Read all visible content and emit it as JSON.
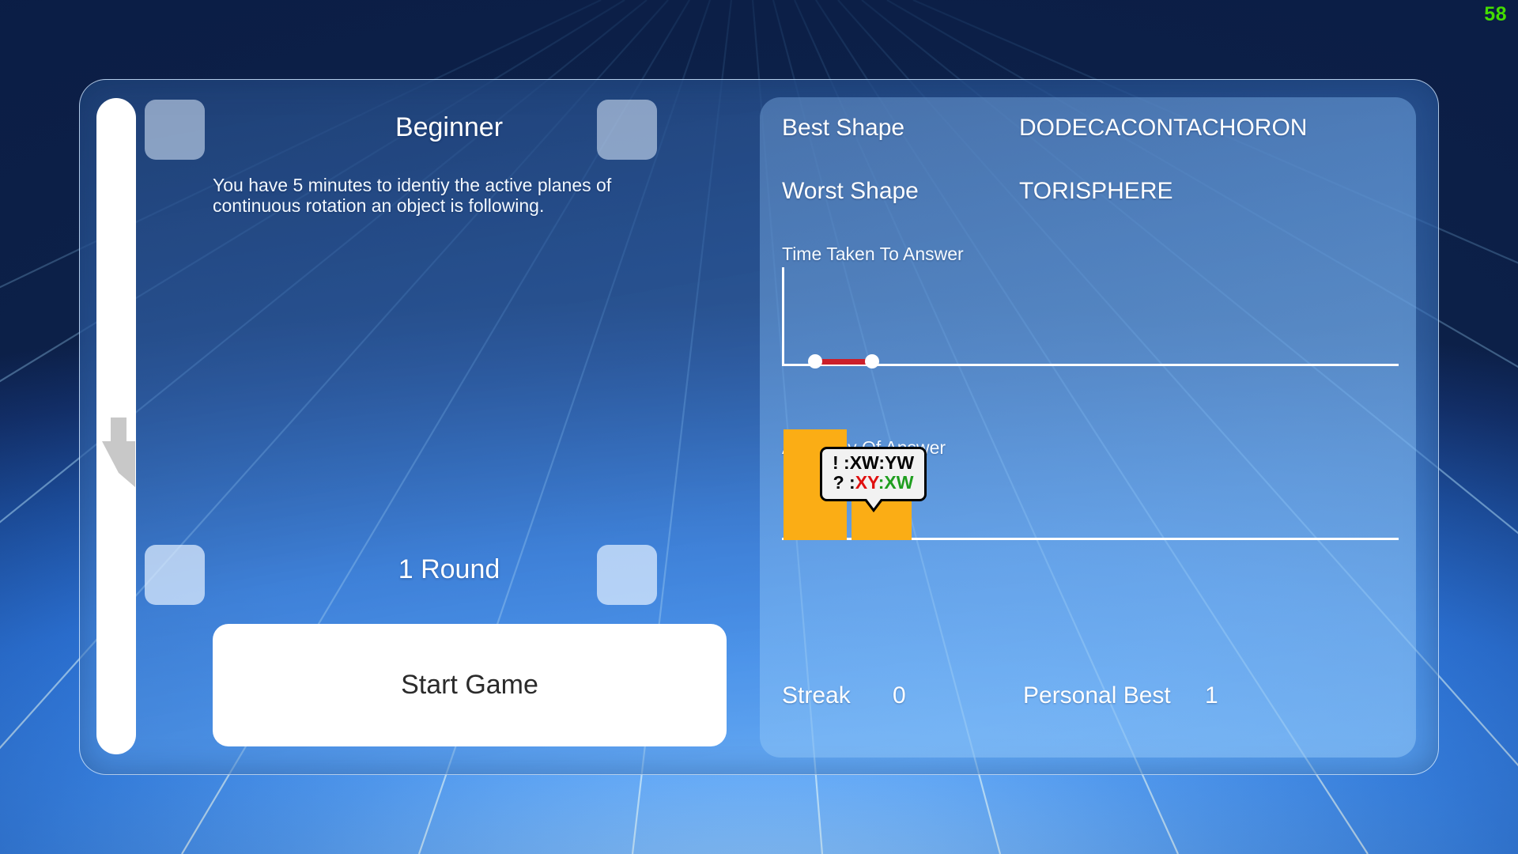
{
  "hud": {
    "fps": "58"
  },
  "difficulty": {
    "label": "Beginner",
    "prev_icon": "chevron-left-icon",
    "next_icon": "chevron-right-icon",
    "description": "You have 5 minutes to identiy the active planes of continuous rotation an object is following."
  },
  "rounds": {
    "label": "1 Round",
    "prev_icon": "chevron-left-icon",
    "next_icon": "chevron-right-icon"
  },
  "start": {
    "label": "Start Game"
  },
  "scrollbar": {
    "handle_icon": "cursor-arrow-icon"
  },
  "stats": {
    "best_shape": {
      "key": "Best Shape",
      "value": "DODECACONTACHORON"
    },
    "worst_shape": {
      "key": "Worst Shape",
      "value": "TORISPHERE"
    },
    "streak": {
      "key": "Streak",
      "value": "0"
    },
    "personal_best": {
      "key": "Personal Best",
      "value": "1"
    }
  },
  "tooltip": {
    "line1_prefix": "! :",
    "line1_value": "XW:YW",
    "line2_prefix": "? :",
    "line2_wrong": "XY",
    "line2_sep": ":",
    "line2_right": "XW"
  },
  "colors": {
    "accent_orange": "#fbad15",
    "line_red": "#cc1f2a",
    "fps_green": "#44dd00",
    "wrong_red": "#e01010",
    "correct_green": "#1f9e1f"
  },
  "chart_data": [
    {
      "type": "line",
      "title": "Time Taken To Answer",
      "xlabel": "",
      "ylabel": "",
      "grid": false,
      "legend": "none",
      "x": [
        1,
        2
      ],
      "series": [
        {
          "name": "Time Taken To Answer",
          "values": [
            0,
            0
          ],
          "color": "#cc1f2a"
        }
      ],
      "ylim": [
        0,
        10
      ],
      "markers": true,
      "marker_color": "#ffffff"
    },
    {
      "type": "bar",
      "title": "Accuracy Of Answer",
      "xlabel": "",
      "ylabel": "",
      "grid": false,
      "legend": "none",
      "categories": [
        "1",
        "2"
      ],
      "values": [
        100,
        40
      ],
      "ylim": [
        0,
        100
      ],
      "bar_color": "#fbad15"
    }
  ]
}
